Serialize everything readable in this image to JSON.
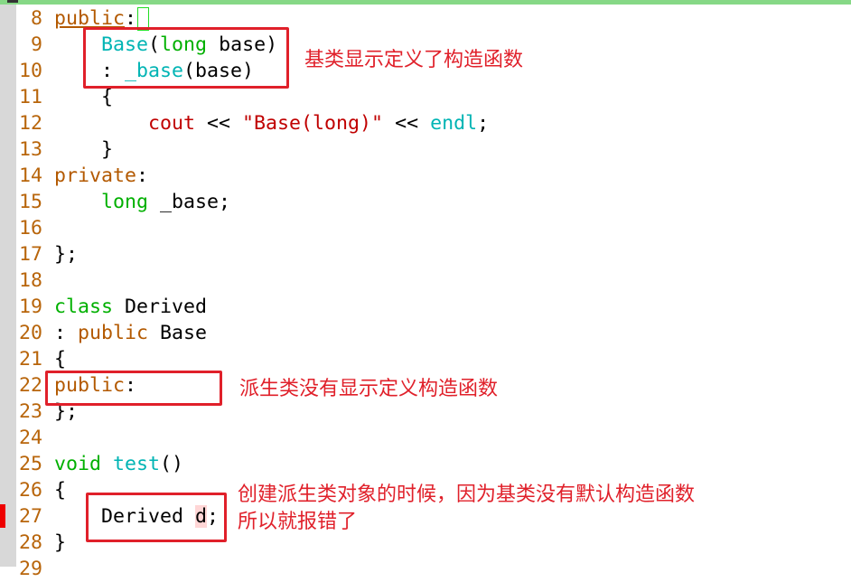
{
  "editor": {
    "lines": [
      {
        "n": "8",
        "tokens": [
          [
            "kw",
            "public"
          ],
          [
            "tx",
            ":"
          ]
        ]
      },
      {
        "n": "9",
        "tokens": [
          [
            "tx",
            "    "
          ],
          [
            "fn",
            "Base"
          ],
          [
            "tx",
            "("
          ],
          [
            "ty",
            "long"
          ],
          [
            "tx",
            " base)"
          ]
        ]
      },
      {
        "n": "10",
        "tokens": [
          [
            "tx",
            "    : "
          ],
          [
            "fn",
            "_base"
          ],
          [
            "tx",
            "(base)"
          ]
        ]
      },
      {
        "n": "11",
        "tokens": [
          [
            "tx",
            "    {"
          ]
        ]
      },
      {
        "n": "12",
        "tokens": [
          [
            "tx",
            "        "
          ],
          [
            "st",
            "cout"
          ],
          [
            "tx",
            " << "
          ],
          [
            "st",
            "\"Base(long)\""
          ],
          [
            "tx",
            " << "
          ],
          [
            "fn",
            "endl"
          ],
          [
            "tx",
            ";"
          ]
        ]
      },
      {
        "n": "13",
        "tokens": [
          [
            "tx",
            "    }"
          ]
        ]
      },
      {
        "n": "14",
        "tokens": [
          [
            "kw",
            "private"
          ],
          [
            "tx",
            ":"
          ]
        ]
      },
      {
        "n": "15",
        "tokens": [
          [
            "tx",
            "    "
          ],
          [
            "ty",
            "long"
          ],
          [
            "tx",
            " _base;"
          ]
        ]
      },
      {
        "n": "16",
        "tokens": []
      },
      {
        "n": "17",
        "tokens": [
          [
            "tx",
            "};"
          ]
        ]
      },
      {
        "n": "18",
        "tokens": []
      },
      {
        "n": "19",
        "tokens": [
          [
            "ty",
            "class"
          ],
          [
            "tx",
            " Derived"
          ]
        ]
      },
      {
        "n": "20",
        "tokens": [
          [
            "tx",
            ": "
          ],
          [
            "kw",
            "public"
          ],
          [
            "tx",
            " Base"
          ]
        ]
      },
      {
        "n": "21",
        "tokens": [
          [
            "tx",
            "{"
          ]
        ]
      },
      {
        "n": "22",
        "tokens": [
          [
            "kw",
            "public"
          ],
          [
            "tx",
            ":"
          ]
        ]
      },
      {
        "n": "23",
        "tokens": [
          [
            "tx",
            "};"
          ]
        ]
      },
      {
        "n": "24",
        "tokens": []
      },
      {
        "n": "25",
        "tokens": [
          [
            "ty",
            "void"
          ],
          [
            "tx",
            " "
          ],
          [
            "fn",
            "test"
          ],
          [
            "tx",
            "()"
          ]
        ]
      },
      {
        "n": "26",
        "tokens": [
          [
            "tx",
            "{"
          ]
        ]
      },
      {
        "n": "27",
        "tokens": [
          [
            "tx",
            "    Derived "
          ],
          [
            "hl",
            "d"
          ],
          [
            "tx",
            ";"
          ]
        ]
      },
      {
        "n": "28",
        "tokens": [
          [
            "tx",
            "}"
          ]
        ]
      },
      {
        "n": "29",
        "tokens": []
      }
    ]
  },
  "annotations": {
    "note1": "基类显示定义了构造函数",
    "note2": "派生类没有显示定义构造函数",
    "note3_line1": "创建派生类对象的时候，因为基类没有默认构造函数",
    "note3_line2": "所以就报错了"
  },
  "colors": {
    "annotation": "#e0202a",
    "keyword": "#b35900",
    "type": "#00b000",
    "function": "#00b4b4"
  }
}
